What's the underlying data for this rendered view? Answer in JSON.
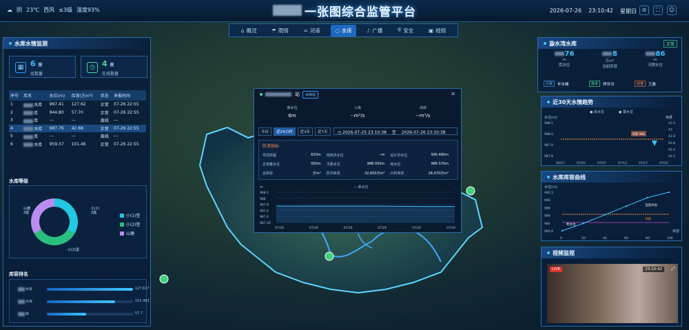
{
  "header": {
    "weather": {
      "condition": "阴",
      "temp": "23℃",
      "wind_dir": "西风",
      "wind_level": "≤3级",
      "humidity": "湿度93%"
    },
    "title": "一张图综合监管平台",
    "date": "2026-07-26",
    "time": "23:10:42",
    "weekday": "星期日",
    "icons": [
      "link-icon",
      "fullscreen-icon",
      "user-icon"
    ]
  },
  "nav": [
    {
      "label": "概况",
      "icon": "home-icon"
    },
    {
      "label": "雨情",
      "icon": "cloud-rain-icon"
    },
    {
      "label": "河道",
      "icon": "river-icon"
    },
    {
      "label": "水库",
      "icon": "drop-icon",
      "active": true
    },
    {
      "label": "广播",
      "icon": "speaker-icon"
    },
    {
      "label": "安全",
      "icon": "shield-icon"
    },
    {
      "label": "视频",
      "icon": "camera-icon"
    }
  ],
  "left": {
    "reservoir_panel": {
      "title": "水库水情监测",
      "stats": [
        {
          "value": "6",
          "unit": "座",
          "label": "总数量"
        },
        {
          "value": "4",
          "unit": "座",
          "label": "在线数量"
        }
      ],
      "table": {
        "headers": [
          "序号",
          "库名",
          "水位(m)",
          "库容(万m³)",
          "状态",
          "来报时间"
        ],
        "rows": [
          {
            "no": "1",
            "name": "水库",
            "level": "967.41",
            "capacity": "127.62",
            "status": "正常",
            "time": "07-26 22:55"
          },
          {
            "no": "2",
            "name": "库",
            "level": "944.80",
            "capacity": "57.70",
            "status": "正常",
            "time": "07-26 22:55"
          },
          {
            "no": "3",
            "name": "库",
            "level": "---",
            "capacity": "---",
            "status": "离线",
            "time": "---"
          },
          {
            "no": "4",
            "name": "水库",
            "level": "987.76",
            "capacity": "42.68",
            "status": "正常",
            "time": "07-26 22:55",
            "selected": true
          },
          {
            "no": "5",
            "name": "库",
            "level": "---",
            "capacity": "---",
            "status": "离线",
            "time": "---"
          },
          {
            "no": "6",
            "name": "水库",
            "level": "959.37",
            "capacity": "101.46",
            "status": "正常",
            "time": "07-26 22:55"
          }
        ]
      }
    },
    "grade": {
      "title": "水库等级",
      "labels": {
        "shanTang": "山塘\n2座",
        "xiao1": "小(1)型\n2座",
        "xiao2": "小(2)型\n2座"
      },
      "legend": [
        {
          "label": "小(1)型",
          "color": "#22c7e0"
        },
        {
          "label": "小(2)型",
          "color": "#2bbf7e"
        },
        {
          "label": "山塘",
          "color": "#b98cf0"
        }
      ],
      "chart_data": {
        "type": "pie",
        "categories": [
          "小(1)型",
          "小(2)型",
          "山塘"
        ],
        "values": [
          2,
          2,
          2
        ]
      }
    },
    "ranking": {
      "title": "库容排名",
      "chart_data": {
        "type": "bar",
        "categories": [
          "水库",
          "水库",
          "库"
        ],
        "values": [
          127.617,
          101.462,
          57.7
        ]
      }
    }
  },
  "popup": {
    "title": "站",
    "badge": "水库站",
    "gauges": [
      {
        "label": "库水位",
        "value": "6m"
      },
      {
        "label": "入库",
        "value": "--m³/s"
      },
      {
        "label": "出库",
        "value": "--m³/s"
      }
    ],
    "tabs": [
      "今日",
      "近24小时",
      "近3天",
      "近7天"
    ],
    "active_tab": "近24小时",
    "start": "2026-07-25 23:10:38",
    "separator": "至",
    "end": "2026-07-26 23:10:38",
    "realtime_title": "防洪指标",
    "metrics": [
      {
        "label": "坝顶高程",
        "value": "650m"
      },
      {
        "label": "校核洪水位",
        "value": "--m"
      },
      {
        "label": "设计洪水位",
        "value": "990.480m"
      },
      {
        "label": "正常蓄水位",
        "value": "000m"
      },
      {
        "label": "汛限水位",
        "value": "988.000m"
      },
      {
        "label": "死水位",
        "value": "986.570m"
      },
      {
        "label": "总库容",
        "value": "万m³"
      },
      {
        "label": "防洪库容",
        "value": "32.850万m³"
      },
      {
        "label": "兴利库容",
        "value": "26.470万m³"
      }
    ],
    "chart_data": {
      "type": "line",
      "title": "库水位",
      "ylabel": "m",
      "x": [
        "07/26",
        "07/26",
        "07/26",
        "07/26",
        "07/26",
        "07/26"
      ],
      "yticks": [
        "988.2",
        "988",
        "987.8",
        "987.6",
        "987.4",
        "987.26"
      ],
      "series": [
        {
          "name": "库水位",
          "values": [
            987.77,
            987.77,
            987.77,
            987.77,
            987.76,
            987.76
          ]
        }
      ],
      "ylim": [
        987.26,
        988.2
      ]
    }
  },
  "right": {
    "station": {
      "title": "漩水湾水库",
      "status": "正常",
      "stats": [
        {
          "value": "76",
          "unit": "m",
          "label": "库水位"
        },
        {
          "value": "8",
          "unit": "万m³",
          "label": "当前库容"
        },
        {
          "value": "86",
          "unit": "m",
          "label": "汛限水位"
        }
      ],
      "managers": [
        {
          "role": "行政",
          "name": "牟永峰"
        },
        {
          "role": "技术",
          "name": "熊世功"
        },
        {
          "role": "巡查",
          "name": "王磊"
        }
      ]
    },
    "trend": {
      "title": "近30天水情趋势",
      "legend": [
        "库水位",
        "警水位"
      ],
      "y_left_label": "水位(m)",
      "y_right_label": "雨量",
      "callout": "汛限 986",
      "chart_data": {
        "type": "line",
        "x": [
          "06/27",
          "07/02",
          "07/07",
          "07/12",
          "07/17",
          "07/22"
        ],
        "yticks_left": [
          "988.5",
          "988.0",
          "987.9",
          "987.8"
        ],
        "yticks_right": [
          "43.2",
          "43",
          "42.8",
          "42.6",
          "42.4",
          "42.2"
        ],
        "series": [
          {
            "name": "库水位",
            "values": [
              987.76,
              987.76,
              987.76,
              987.76,
              987.77,
              987.76
            ]
          }
        ]
      }
    },
    "curve": {
      "title": "水库库容曲线",
      "ylabel": "水位(m)",
      "xlabel": "库容",
      "label_current": "当前水位",
      "label_limit": "汛限",
      "label_dead": "死水位",
      "chart_data": {
        "type": "line",
        "x": [
          0,
          20,
          40,
          60,
          80,
          100
        ],
        "yticks": [
          "982.2",
          "990",
          "988",
          "986",
          "984",
          "982.8"
        ],
        "series": [
          {
            "name": "库容曲线",
            "values": [
              982.8,
              984.2,
              985.8,
              987.4,
              989.0,
              990.0
            ]
          }
        ]
      }
    },
    "video": {
      "title": "视频监视",
      "live": "LIVE",
      "time": "23:10:42"
    }
  }
}
